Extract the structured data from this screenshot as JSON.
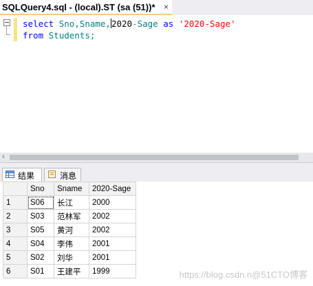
{
  "document_tab": {
    "title": "SQLQuery4.sql - (local).ST (sa (51))*",
    "close_glyph": "×"
  },
  "editor": {
    "line1": {
      "keyword_select": "select",
      "columns": "Sno,Sname,",
      "after_caret": "2020",
      "op": "-",
      "sage": "Sage",
      "keyword_as": "as",
      "alias": "'2020-Sage'"
    },
    "line2": {
      "keyword_from": "from",
      "table": "Students;"
    }
  },
  "result_tabs": [
    {
      "label": "结果",
      "icon": "grid-icon",
      "active": true
    },
    {
      "label": "消息",
      "icon": "message-icon",
      "active": false
    }
  ],
  "grid": {
    "columns": [
      "Sno",
      "Sname",
      "2020-Sage"
    ],
    "rows": [
      {
        "n": "1",
        "sno": "S06",
        "sname": "长江",
        "age": "2000"
      },
      {
        "n": "2",
        "sno": "S03",
        "sname": "范林军",
        "age": "2002"
      },
      {
        "n": "3",
        "sno": "S05",
        "sname": "黄河",
        "age": "2002"
      },
      {
        "n": "4",
        "sno": "S04",
        "sname": "李伟",
        "age": "2001"
      },
      {
        "n": "5",
        "sno": "S02",
        "sname": "刘华",
        "age": "2001"
      },
      {
        "n": "6",
        "sno": "S01",
        "sname": "王建平",
        "age": "1999"
      }
    ]
  },
  "watermark": "https://blog.csdn.n@51CTO博客",
  "colors": {
    "keyword": "#0000ff",
    "identifier": "#008080",
    "string": "#ff0000",
    "tab_underline": "#f5cc84"
  }
}
